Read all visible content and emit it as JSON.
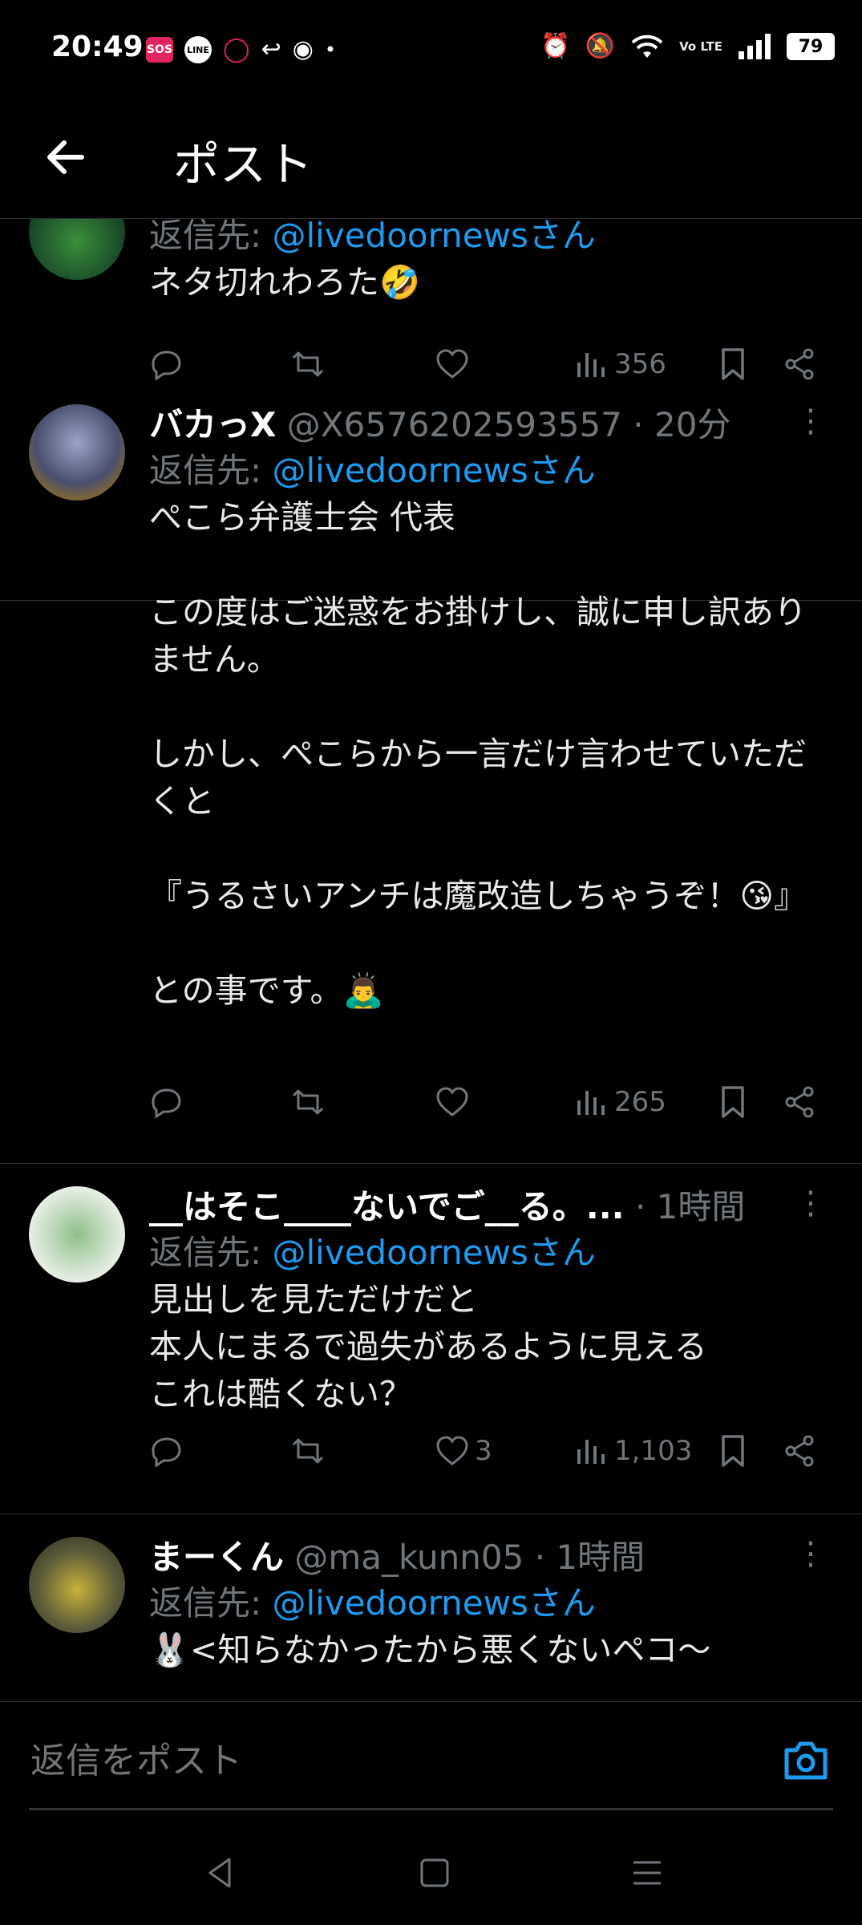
{
  "status_bar": {
    "time": "20:49",
    "battery": "79",
    "network": "Vo LTE"
  },
  "header": {
    "title": "ポスト"
  },
  "posts": [
    {
      "display_name": "",
      "handle": "",
      "time": "",
      "reply_prefix": "返信先:",
      "reply_mention": "@livedoornewsさん",
      "body": "ネタ切れわろた🤣",
      "replies": "",
      "reposts": "",
      "likes": "",
      "views": "356"
    },
    {
      "display_name": "バカっX",
      "handle": "@X6576202593557",
      "time": "· 20分",
      "reply_prefix": "返信先:",
      "reply_mention": "@livedoornewsさん",
      "body": "ぺこら弁護士会 代表\n\nこの度はご迷惑をお掛けし、誠に申し訳ありません。\n\nしかし、ぺこらから一言だけ言わせていただくと\n\n『うるさいアンチは魔改造しちゃうぞ！😘』\n\nとの事です。🙇‍♂️",
      "replies": "",
      "reposts": "",
      "likes": "",
      "views": "265"
    },
    {
      "display_name": "__はそこ____ないでご__る。...",
      "handle": "",
      "time": "· 1時間",
      "reply_prefix": "返信先:",
      "reply_mention": "@livedoornewsさん",
      "body": "見出しを見ただけだと\n本人にまるで過失があるように見える\nこれは酷くない？",
      "replies": "",
      "reposts": "",
      "likes": "3",
      "views": "1,103"
    },
    {
      "display_name": "まーくん",
      "handle": "@ma_kunn05",
      "time": "· 1時間",
      "reply_prefix": "返信先:",
      "reply_mention": "@livedoornewsさん",
      "body": "🐰<知らなかったから悪くないペコ〜",
      "replies": "",
      "reposts": "",
      "likes": "",
      "views": ""
    }
  ],
  "reply_bar": {
    "placeholder": "返信をポスト"
  },
  "colors": {
    "background": "#000000",
    "accent": "#1d9bf0",
    "muted": "#71767b",
    "divider": "#2f3336"
  }
}
